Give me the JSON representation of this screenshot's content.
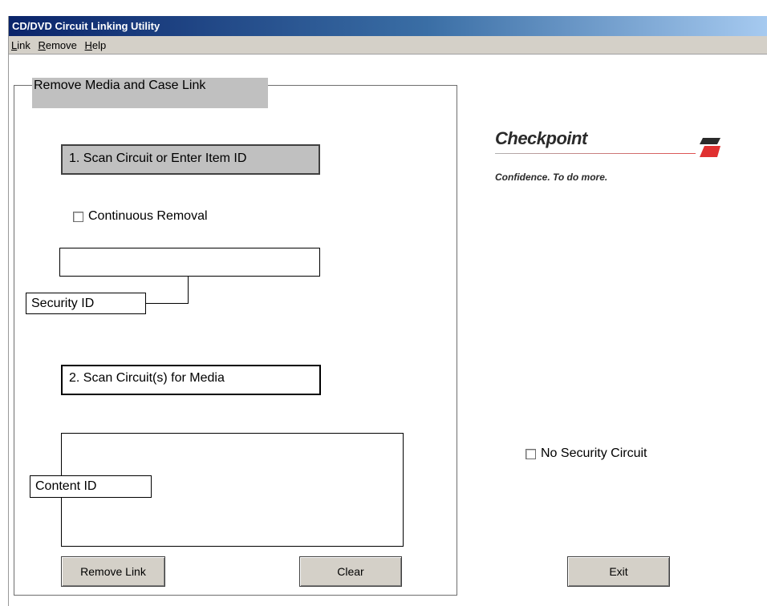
{
  "window": {
    "title": "CD/DVD Circuit Linking Utility"
  },
  "menu": {
    "items": [
      "Link",
      "Remove",
      "Help"
    ]
  },
  "group": {
    "title": "Remove Media and Case Link"
  },
  "step1": {
    "label": "1. Scan Circuit or Enter Item ID"
  },
  "continuous": {
    "label": "Continuous Removal",
    "checked": false
  },
  "security": {
    "value": "",
    "label": "Security ID"
  },
  "step2": {
    "label": "2. Scan Circuit(s) for Media"
  },
  "content": {
    "value": "",
    "label": "Content ID"
  },
  "buttons": {
    "remove_link": "Remove Link",
    "clear": "Clear",
    "exit": "Exit"
  },
  "no_security": {
    "label": "No Security Circuit",
    "checked": false
  },
  "logo": {
    "name": "Checkpoint",
    "tagline": "Confidence. To do more."
  },
  "colors": {
    "titlebar_start": "#0a246a",
    "titlebar_end": "#a6caf0",
    "panel_gray": "#c0c0c0",
    "logo_accent": "#e03030"
  }
}
